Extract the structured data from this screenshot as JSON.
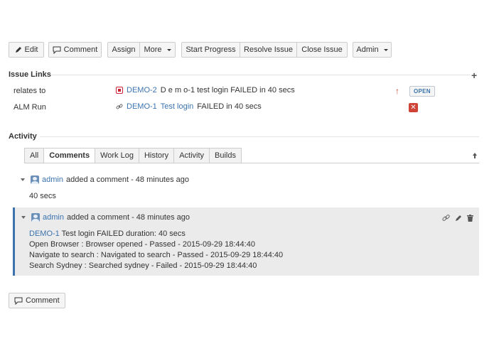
{
  "toolbar": {
    "edit": "Edit",
    "comment": "Comment",
    "assign": "Assign",
    "more": "More",
    "start_progress": "Start Progress",
    "resolve_issue": "Resolve Issue",
    "close_issue": "Close Issue",
    "admin": "Admin"
  },
  "issue_links": {
    "heading": "Issue Links",
    "rows": [
      {
        "type": "relates to",
        "key": "DEMO-2",
        "summary": "D e m o-1 test login FAILED in 40 secs",
        "priority": "↑",
        "status": "OPEN"
      },
      {
        "type": "ALM Run",
        "key": "DEMO-1",
        "summary_link": "Test login",
        "summary_rest": "FAILED in 40 secs",
        "status_icon": "✕"
      }
    ]
  },
  "activity": {
    "heading": "Activity",
    "tabs": [
      "All",
      "Comments",
      "Work Log",
      "History",
      "Activity",
      "Builds"
    ],
    "active_tab": "Comments",
    "comments": [
      {
        "author": "admin",
        "meta": "added a comment - 48 minutes ago",
        "body": [
          "40 secs"
        ]
      },
      {
        "author": "admin",
        "meta": "added a comment - 48 minutes ago",
        "first_line_link": "DEMO-1",
        "first_line_rest": "Test login FAILED duration: 40 secs",
        "body": [
          "Open Browser : Browser opened - Passed - 2015-09-29 18:44:40",
          "Navigate to search : Navigated to search - Passed - 2015-09-29 18:44:40",
          "Search Sydney : Searched sydney - Failed - 2015-09-29 18:44:40"
        ]
      }
    ]
  },
  "footer": {
    "comment_button": "Comment"
  },
  "colors": {
    "link": "#3b73af",
    "error": "#d04437",
    "focus_bar": "#3b73af"
  }
}
